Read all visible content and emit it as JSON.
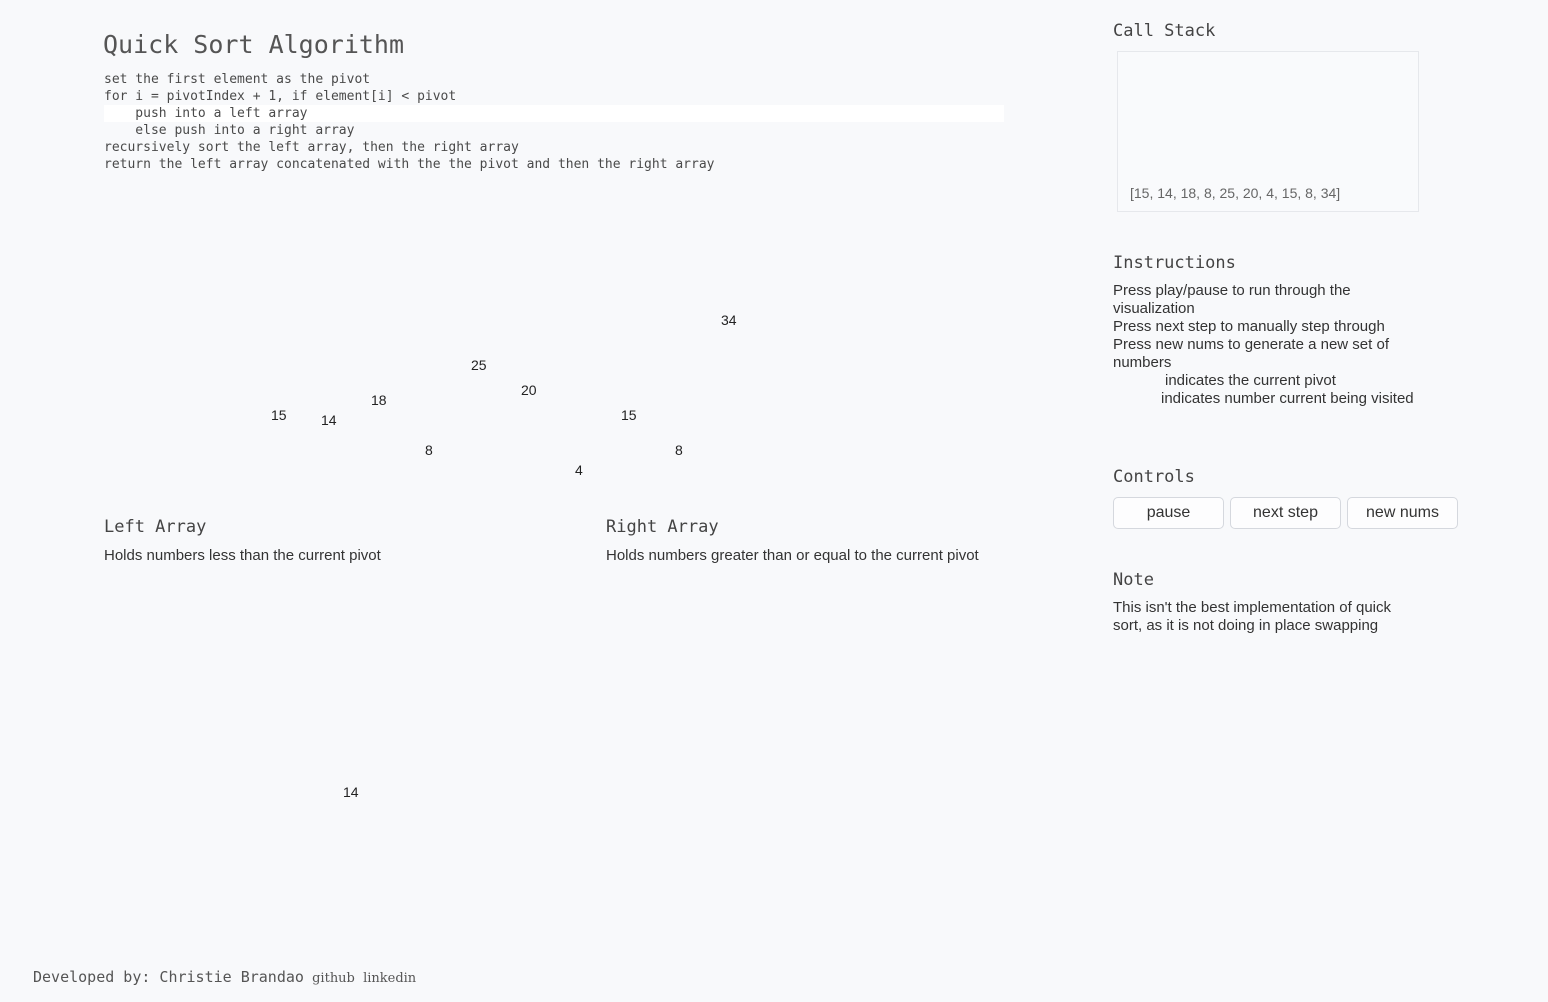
{
  "title": "Quick Sort Algorithm",
  "pseudocode": [
    "set the first element as the pivot",
    "for i = pivotIndex + 1, if element[i] < pivot",
    "    push into a left array",
    "    else push into a right array",
    "recursively sort the left array, then the right array",
    "return the left array concatenated with the the pivot and then the right array"
  ],
  "visualization": {
    "numbers": [
      "15",
      "14",
      "18",
      "8",
      "25",
      "20",
      "4",
      "15",
      "8",
      "34"
    ],
    "current": "14"
  },
  "left_array": {
    "title": "Left Array",
    "description": "Holds numbers less than the current pivot"
  },
  "right_array": {
    "title": "Right Array",
    "description": "Holds numbers greater than or equal to the current pivot"
  },
  "call_stack": {
    "title": "Call Stack",
    "entries": [
      "[15, 14, 18, 8, 25, 20, 4, 15, 8, 34]"
    ]
  },
  "instructions": {
    "title": "Instructions",
    "lines": [
      "Press play/pause to run through the visualization",
      "Press next step to manually step through",
      "Press new nums to generate a new set of numbers",
      "indicates the current pivot",
      "indicates number current being visited"
    ]
  },
  "controls": {
    "title": "Controls",
    "pause_label": "pause",
    "next_step_label": "next step",
    "new_nums_label": "new nums"
  },
  "note": {
    "title": "Note",
    "text": "This isn't the best implementation of quick sort, as it is not doing in place swapping"
  },
  "footer": {
    "developed_by": "Developed by: Christie Brandao",
    "github": "github",
    "linkedin": "linkedin"
  }
}
